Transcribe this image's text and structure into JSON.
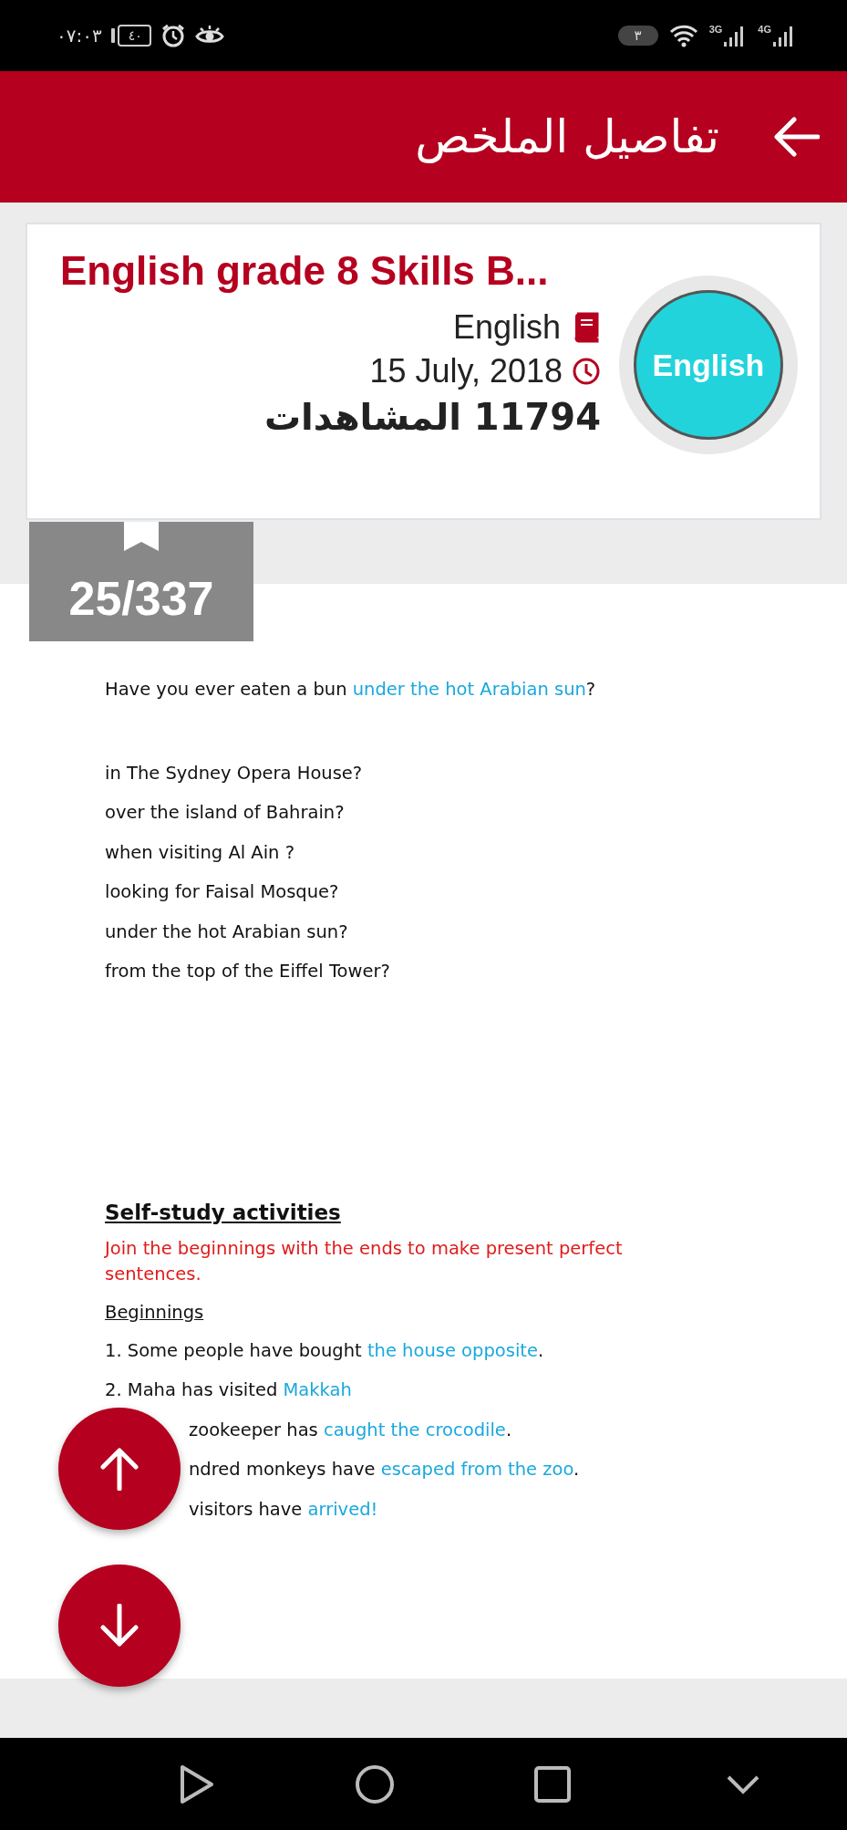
{
  "status_bar": {
    "time": "٠٧:٠٣",
    "battery": "٤٠",
    "notification_count": "٣",
    "network_1": "3G",
    "network_2": "4G"
  },
  "header": {
    "title": "تفاصيل الملخص"
  },
  "summary": {
    "title": "English grade 8 Skills B...",
    "subject": "English",
    "date": "15 July, 2018",
    "views": "11794 المشاهدات",
    "avatar": "English"
  },
  "page_counter": "25/337",
  "document": {
    "intro": [
      {
        "text": "Have you ever eaten a bun ",
        "highlight": false
      },
      {
        "text": "under the hot Arabian sun",
        "highlight": true
      },
      {
        "text": "?",
        "highlight": false
      }
    ],
    "lines": [
      "in The Sydney Opera House?",
      "over the island of Bahrain?",
      "when visiting Al Ain ?",
      "looking for Faisal Mosque?",
      "under the hot Arabian sun?",
      "from the top of the Eiffel Tower?"
    ],
    "self_study": {
      "heading": "Self-study activities",
      "instruction": "Join the beginnings with the ends to make present perfect sentences.",
      "subheading": "Beginnings",
      "items": [
        {
          "kind": "full",
          "parts": [
            {
              "text": "1. Some people have bought  ",
              "highlight": false
            },
            {
              "text": "the house opposite",
              "highlight": true
            },
            {
              "text": ".",
              "highlight": false
            }
          ]
        },
        {
          "kind": "full",
          "parts": [
            {
              "text": "2. Maha has visited ",
              "highlight": false
            },
            {
              "text": "Makkah",
              "highlight": true
            }
          ]
        },
        {
          "kind": "partial",
          "parts": [
            {
              "text": "zookeeper has ",
              "highlight": false
            },
            {
              "text": "caught the crocodile",
              "highlight": true
            },
            {
              "text": ".",
              "highlight": false
            }
          ]
        },
        {
          "kind": "partial",
          "parts": [
            {
              "text": "ndred monkeys have ",
              "highlight": false
            },
            {
              "text": "escaped from the zoo",
              "highlight": true
            },
            {
              "text": ".",
              "highlight": false
            }
          ]
        },
        {
          "kind": "partial",
          "parts": [
            {
              "text": "visitors have ",
              "highlight": false
            },
            {
              "text": "arrived!",
              "highlight": true
            }
          ]
        }
      ]
    }
  }
}
